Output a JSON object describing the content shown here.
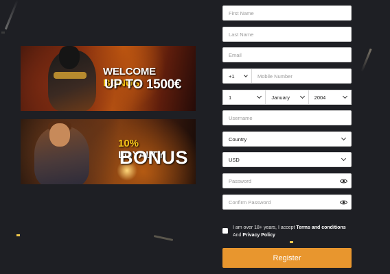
{
  "banners": {
    "welcome": {
      "line1_prefix": "WELCOME ",
      "line1_highlight": "BONUS",
      "line2": "UP TO 1500€"
    },
    "loyalty": {
      "line1_highlight": "10%",
      "line1_suffix": " LOYALTY",
      "line2": "BONUS"
    }
  },
  "form": {
    "first_name_placeholder": "First Name",
    "last_name_placeholder": "Last Name",
    "email_placeholder": "Email",
    "phone_prefix": "+1",
    "mobile_placeholder": "Mobile Number",
    "dob_day": "1",
    "dob_month": "January",
    "dob_year": "2004",
    "username_placeholder": "Username",
    "country": "Country",
    "currency": "USD",
    "password_placeholder": "Password",
    "confirm_password_placeholder": "Confirm Password"
  },
  "terms": {
    "prefix": "I am over 18+ years, I accept ",
    "terms_link": "Terms and conditions",
    "and": " And ",
    "privacy_link": "Privacy Policy"
  },
  "register_label": "Register",
  "colors": {
    "background": "#1e1f24",
    "accent": "#e8962e",
    "highlight": "#f5c518"
  }
}
